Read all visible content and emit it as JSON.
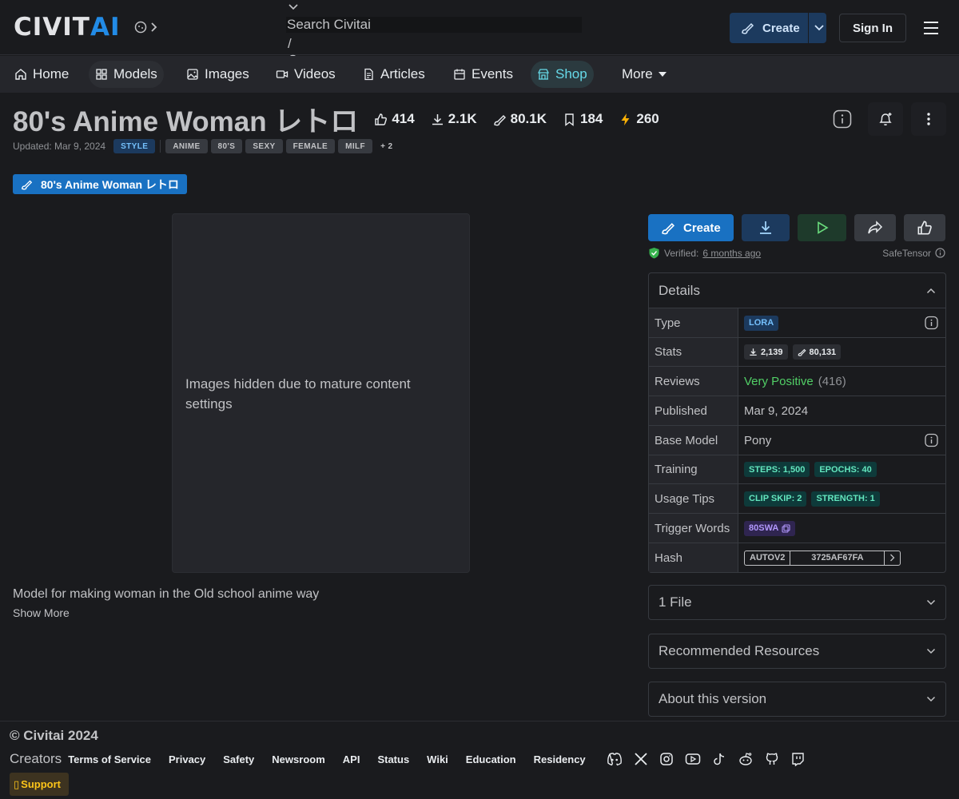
{
  "brand": {
    "civit": "CIVIT",
    "ai": "AI"
  },
  "search": {
    "placeholder": "Search Civitai",
    "shortcut": "/"
  },
  "header": {
    "create_label": "Create",
    "signin_label": "Sign In"
  },
  "nav": {
    "home": "Home",
    "models": "Models",
    "images": "Images",
    "videos": "Videos",
    "articles": "Articles",
    "events": "Events",
    "shop": "Shop",
    "more": "More"
  },
  "model": {
    "title": "80's Anime Woman レトロ",
    "stats": {
      "likes": "414",
      "downloads": "2.1K",
      "generations": "80.1K",
      "bookmarks": "184",
      "buzz": "260"
    },
    "updated": "Updated: Mar 9, 2024",
    "category_tag": "STYLE",
    "tags": [
      "ANIME",
      "80'S",
      "SEXY",
      "FEMALE",
      "MILF"
    ],
    "more_tags": "+ 2",
    "version_name": "80's Anime Woman レトロ",
    "hidden_message": "Images hidden due to mature content settings",
    "description": "Model for making woman in the Old school anime way",
    "show_more": "Show More"
  },
  "actions": {
    "create_label": "Create",
    "verified_label": "Verified:",
    "verified_time": "6 months ago",
    "file_format": "SafeTensor"
  },
  "details": {
    "heading": "Details",
    "rows": {
      "type_label": "Type",
      "type_value": "LORA",
      "stats_label": "Stats",
      "stats_downloads": "2,139",
      "stats_generations": "80,131",
      "reviews_label": "Reviews",
      "reviews_value": "Very Positive",
      "reviews_count": "(416)",
      "published_label": "Published",
      "published_value": "Mar 9, 2024",
      "base_label": "Base Model",
      "base_value": "Pony",
      "training_label": "Training",
      "training_steps": "STEPS: 1,500",
      "training_epochs": "EPOCHS: 40",
      "usage_label": "Usage Tips",
      "usage_clip": "CLIP SKIP: 2",
      "usage_strength": "STRENGTH: 1",
      "trigger_label": "Trigger Words",
      "trigger_value": "80SWA",
      "hash_label": "Hash",
      "hash_type": "AUTOV2",
      "hash_value": "3725AF67FA"
    }
  },
  "accordions": {
    "files": "1 File",
    "recommended": "Recommended Resources",
    "about": "About this version"
  },
  "footer": {
    "copyright": "© Civitai 2024",
    "creators": "Creators",
    "links": [
      "Terms of Service",
      "Privacy",
      "Safety",
      "Newsroom",
      "API",
      "Status",
      "Wiki",
      "Education",
      "Residency"
    ],
    "support": "Support",
    "socials": [
      "discord-icon",
      "x-icon",
      "instagram-icon",
      "youtube-icon",
      "tiktok-icon",
      "reddit-icon",
      "github-icon",
      "twitch-icon"
    ]
  },
  "colors": {
    "accent": "#228be6",
    "background": "#1a1b1e",
    "positive": "#51cf66",
    "buzz": "#fab005"
  }
}
